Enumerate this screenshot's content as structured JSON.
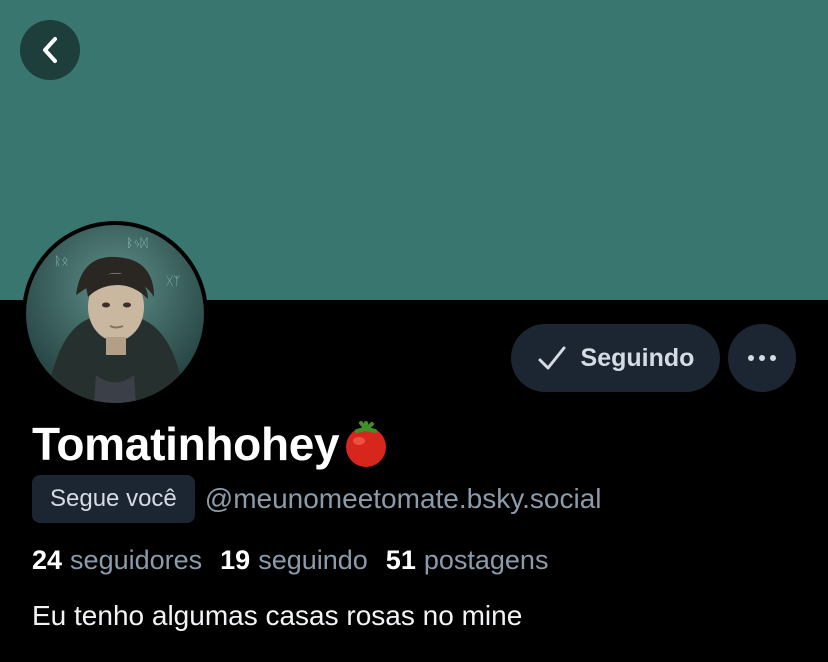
{
  "header": {
    "back_icon": "chevron-left-icon",
    "banner_color": "#3a7670"
  },
  "profile": {
    "display_name": "Tomatinhohey",
    "name_emoji": "🍅",
    "follows_you_label": "Segue você",
    "handle": "@meunomeetomate.bsky.social",
    "bio": "Eu tenho algumas casas rosas no mine"
  },
  "actions": {
    "following_label": "Seguindo",
    "following_icon": "check-icon",
    "more_icon": "ellipsis-icon"
  },
  "stats": {
    "followers_count": "24",
    "followers_label": "seguidores",
    "following_count": "19",
    "following_label": "seguindo",
    "posts_count": "51",
    "posts_label": "postagens"
  }
}
